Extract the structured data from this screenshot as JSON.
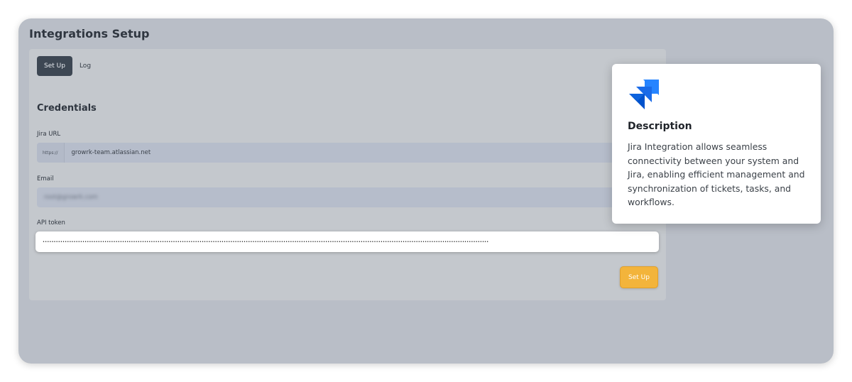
{
  "page": {
    "title": "Integrations Setup"
  },
  "tabs": [
    {
      "label": "Set Up",
      "active": true
    },
    {
      "label": "Log",
      "active": false
    }
  ],
  "credentials": {
    "section_title": "Credentials",
    "jira_url": {
      "label": "Jira URL",
      "prefix": "https://",
      "value": "growrk-team.atlassian.net"
    },
    "email": {
      "label": "Email",
      "value": "root@growrk.com"
    },
    "api_token": {
      "label": "API token",
      "value": "••••••••••••••••••••••••••••••••••••••••••••••••••••••••••••••••••••••••••••••••••••••••••••••••••••••••••••••••••••••••••••••••••••••••••••••••••••••••••••••••••••••••••••••••••••••••••••••••••••••••••"
    },
    "submit_label": "Set Up"
  },
  "description": {
    "icon": "jira-logo-icon",
    "title": "Description",
    "text": "Jira Integration allows seamless connectivity between your system and Jira, enabling efficient management and synchronization of tickets, tasks, and workflows."
  },
  "colors": {
    "frame_bg": "#b9bec7",
    "panel_bg": "#c4c8cd",
    "active_tab": "#3d4753",
    "button": "#f3b43b",
    "jira_blue_light": "#2684ff",
    "jira_blue_dark": "#0052cc"
  }
}
